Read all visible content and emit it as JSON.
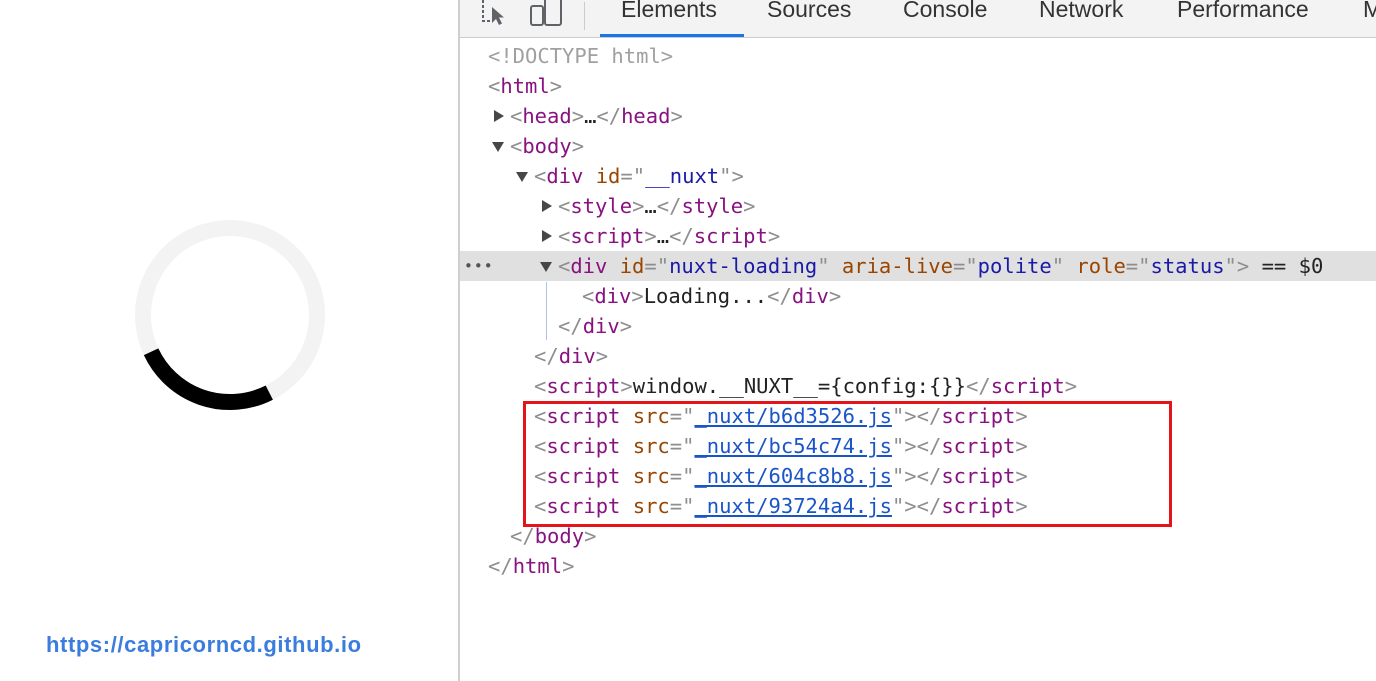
{
  "page": {
    "spinner_icon": "loading-spinner-icon",
    "watermark": "https://capricorncd.github.io"
  },
  "devtools": {
    "toolbar": {
      "inspect_icon": "inspect-element-icon",
      "device_icon": "device-toolbar-icon",
      "tabs": [
        {
          "label": "Elements",
          "active": true
        },
        {
          "label": "Sources",
          "active": false
        },
        {
          "label": "Console",
          "active": false
        },
        {
          "label": "Network",
          "active": false
        },
        {
          "label": "Performance",
          "active": false
        },
        {
          "label": "M",
          "active": false
        }
      ]
    },
    "dom": {
      "doctype": "<!DOCTYPE html>",
      "html_open": "html",
      "head": {
        "tag": "head",
        "collapsed": "…"
      },
      "body_tag": "body",
      "nuxt_div": {
        "tag": "div",
        "attr_name": "id",
        "attr_value": "__nuxt"
      },
      "style": {
        "tag": "style",
        "collapsed": "…"
      },
      "script_collapsed": {
        "tag": "script",
        "collapsed": "…"
      },
      "loading_div": {
        "tag": "div",
        "attrs": [
          {
            "name": "id",
            "value": "nuxt-loading"
          },
          {
            "name": "aria-live",
            "value": "polite"
          },
          {
            "name": "role",
            "value": "status"
          }
        ],
        "selected_marker": " == $0",
        "gutter": "•••"
      },
      "loading_text_div": {
        "tag": "div",
        "text": "Loading..."
      },
      "config_script": {
        "tag": "script",
        "text": "window.__NUXT__={config:{}}"
      },
      "scripts": [
        {
          "tag": "script",
          "attr_name": "src",
          "src": "_nuxt/b6d3526.js"
        },
        {
          "tag": "script",
          "attr_name": "src",
          "src": "_nuxt/bc54c74.js"
        },
        {
          "tag": "script",
          "attr_name": "src",
          "src": "_nuxt/604c8b8.js"
        },
        {
          "tag": "script",
          "attr_name": "src",
          "src": "_nuxt/93724a4.js"
        }
      ]
    }
  },
  "colors": {
    "highlight_box": "#e3151a",
    "active_tab_underline": "#1a73e8",
    "watermark": "#3b7ddd",
    "tag": "#881280",
    "attr_name": "#994500",
    "attr_value": "#1a1aa6",
    "link": "#1a55c7"
  }
}
